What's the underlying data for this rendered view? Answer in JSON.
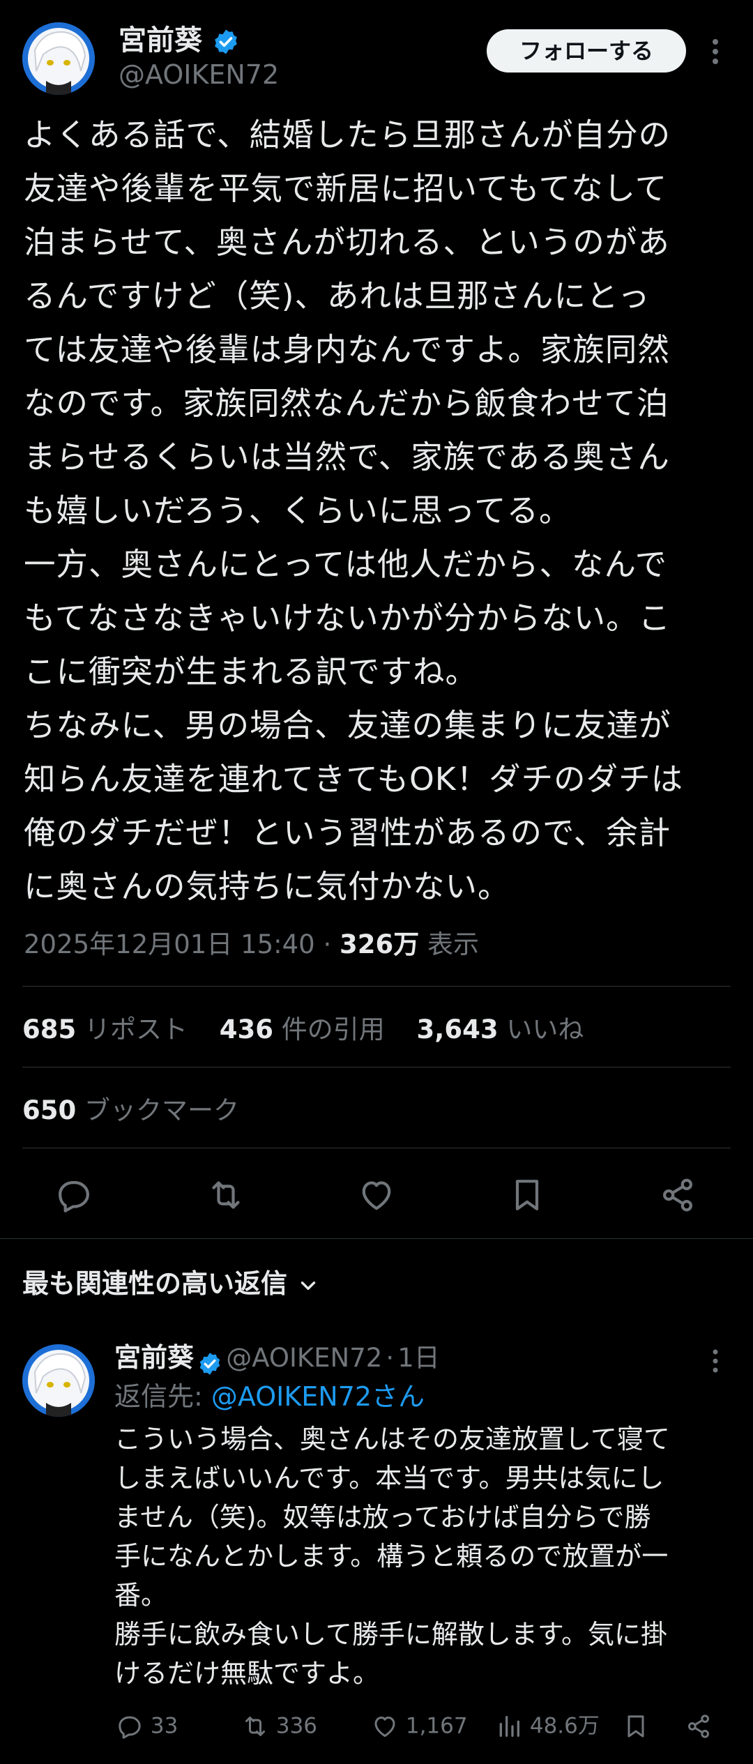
{
  "tweet": {
    "author_name": "宮前葵",
    "handle": "@AOIKEN72",
    "follow_label": "フォローする",
    "body_lines": [
      "よくある話で、結婚したら旦那さんが自分の",
      "友達や後輩を平気で新居に招いてもてなして",
      "泊まらせて、奥さんが切れる、というのがあ",
      "るんですけど（笑)、あれは旦那さんにとっ",
      "ては友達や後輩は身内なんですよ。家族同然",
      "なのです。家族同然なんだから飯食わせて泊",
      "まらせるくらいは当然で、家族である奥さん",
      "も嬉しいだろう、くらいに思ってる。",
      "一方、奥さんにとっては他人だから、なんで",
      "もてなさなきゃいけないかが分からない。こ",
      "こに衝突が生まれる訳ですね。",
      "ちなみに、男の場合、友達の集まりに友達が",
      "知らん友達を連れてきてもOK！ダチのダチは",
      "俺のダチだぜ！という習性があるので、余計",
      "に奥さんの気持ちに気付かない。"
    ],
    "timestamp": "2025年12月01日 15:40",
    "separator": "·",
    "views_count": "326万",
    "views_label": "表示",
    "stats": {
      "reposts_count": "685",
      "reposts_label": "リポスト",
      "quotes_count": "436",
      "quotes_label": "件の引用",
      "likes_count": "3,643",
      "likes_label": "いいね",
      "bookmarks_count": "650",
      "bookmarks_label": "ブックマーク"
    },
    "actions": [
      "reply-icon",
      "repost-icon",
      "like-icon",
      "bookmark-icon",
      "share-icon"
    ]
  },
  "replies_sort": {
    "label": "最も関連性の高い返信"
  },
  "reply": {
    "author_name": "宮前葵",
    "handle": "@AOIKEN72",
    "separator": "·",
    "time": "1日",
    "reply_to_label": "返信先: ",
    "reply_to_handle": "@AOIKEN72さん",
    "body_lines": [
      "こういう場合、奥さんはその友達放置して寝て",
      "しまえばいいんです。本当です。男共は気にし",
      "ません（笑)。奴等は放っておけば自分らで勝",
      "手になんとかします。構うと頼るので放置が一",
      "番。",
      "勝手に飲み食いして勝手に解散します。気に掛",
      "けるだけ無駄ですよ。"
    ],
    "replies": "33",
    "reposts": "336",
    "likes": "1,167",
    "views": "48.6万"
  },
  "colors": {
    "background": "#000000",
    "text": "#e7e9ea",
    "muted": "#71767b",
    "accent": "#1d9bf0",
    "divider": "#2f3336",
    "verified": "#1d9bf0"
  }
}
